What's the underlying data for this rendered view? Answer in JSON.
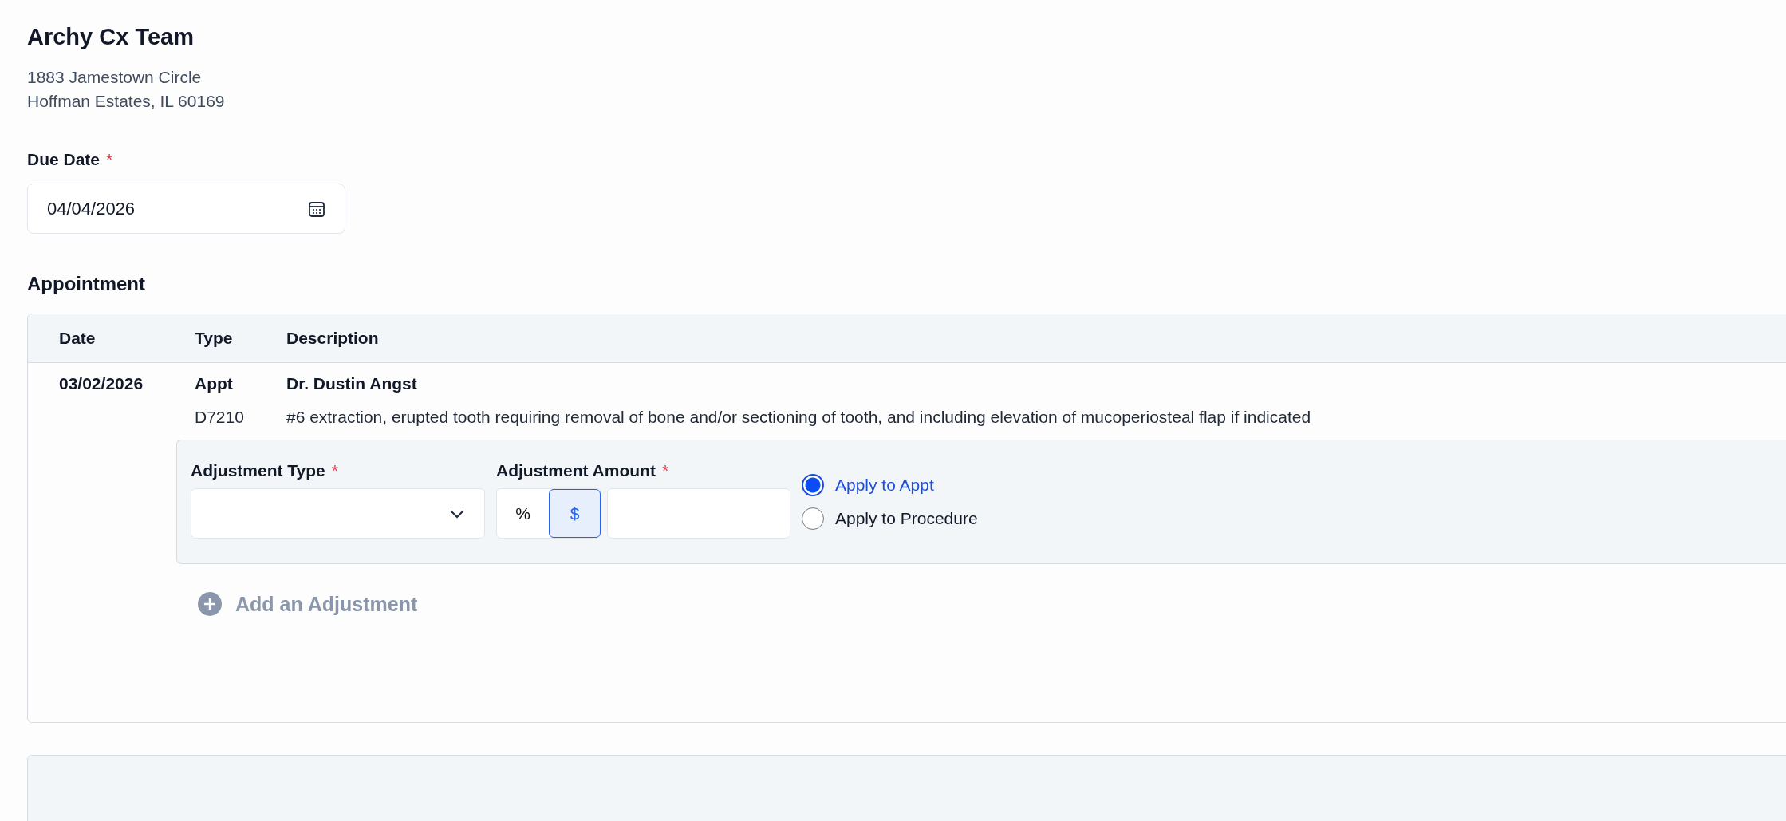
{
  "organization": {
    "name": "Archy Cx Team",
    "address_lines": [
      "1883 Jamestown Circle",
      "Hoffman Estates, IL 60169"
    ]
  },
  "due_date": {
    "label": "Due Date",
    "required_mark": "*",
    "value": "04/04/2026"
  },
  "appointment": {
    "title": "Appointment",
    "columns": [
      "Date",
      "Type",
      "Description"
    ],
    "rows": [
      {
        "kind": "appointment",
        "date": "03/02/2026",
        "type": "Appt",
        "description": "Dr. Dustin Angst"
      },
      {
        "kind": "procedure",
        "type": "D7210",
        "description": "#6 extraction, erupted tooth requiring removal of bone and/or sectioning of tooth, and including elevation of mucoperiosteal flap if indicated"
      }
    ],
    "adjustment": {
      "type_label": "Adjustment Type",
      "type_required_mark": "*",
      "amount_label": "Adjustment Amount",
      "amount_required_mark": "*",
      "units": [
        {
          "label": "%",
          "selected": false
        },
        {
          "label": "$",
          "selected": true
        }
      ],
      "apply_options": [
        {
          "label": "Apply to Appt",
          "selected": true
        },
        {
          "label": "Apply to Procedure",
          "selected": false
        }
      ]
    },
    "add_adjustment": "Add an Adjustment"
  }
}
